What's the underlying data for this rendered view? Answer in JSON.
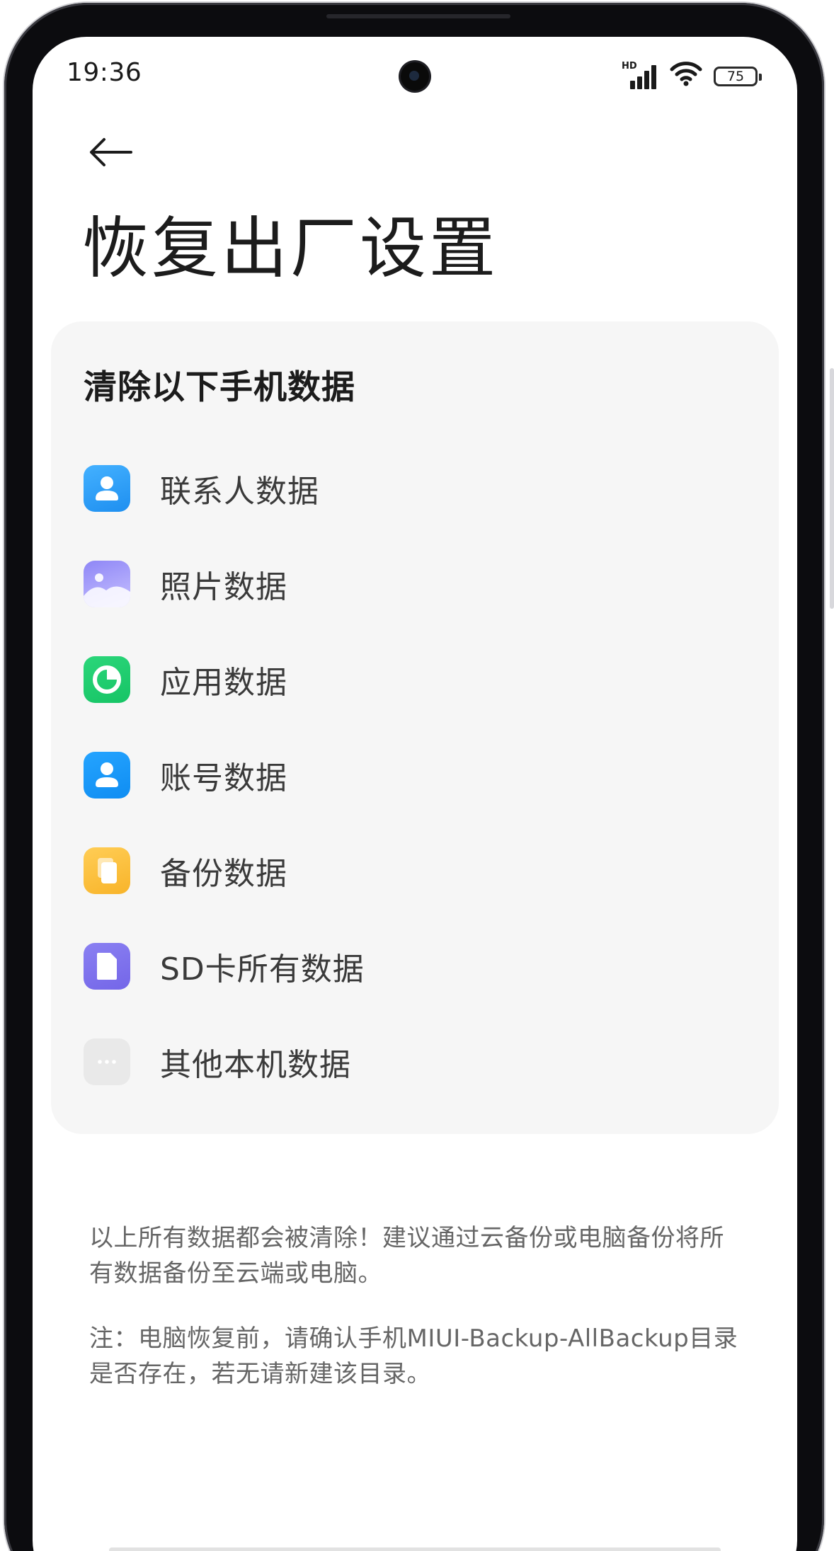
{
  "status_bar": {
    "time": "19:36",
    "network_badge": "HD",
    "battery_level": "75",
    "signal_strength": 4,
    "wifi_strength": 3
  },
  "header": {
    "back_icon": "arrow-left-icon",
    "title": "恢复出厂设置"
  },
  "card": {
    "title": "清除以下手机数据",
    "items": [
      {
        "label": "联系人数据",
        "icon": "contact-icon"
      },
      {
        "label": "照片数据",
        "icon": "photo-icon"
      },
      {
        "label": "应用数据",
        "icon": "pie-chart-icon"
      },
      {
        "label": "账号数据",
        "icon": "account-icon"
      },
      {
        "label": "备份数据",
        "icon": "backup-icon"
      },
      {
        "label": "SD卡所有数据",
        "icon": "sd-card-icon"
      },
      {
        "label": "其他本机数据",
        "icon": "more-icon"
      }
    ]
  },
  "notes": {
    "warning": "以上所有数据都会被清除！建议通过云备份或电脑备份将所有数据备份至云端或电脑。",
    "tip": "注：电脑恢复前，请确认手机MIUI-Backup-AllBackup目录是否存在，若无请新建该目录。"
  },
  "colors": {
    "contacts": "#2a9bf8",
    "photos": "#8e86f6",
    "apps": "#1fce6f",
    "account": "#1798f8",
    "backup": "#fbc13e",
    "sd_card": "#7f73ee",
    "other": "#e9e9e9",
    "card_background": "#f6f6f6",
    "note_text": "#666666"
  }
}
